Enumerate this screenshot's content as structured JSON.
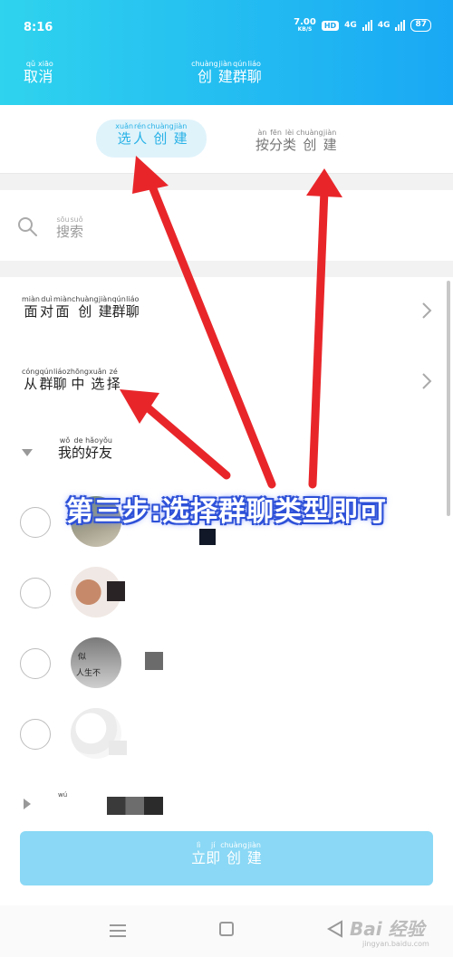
{
  "status_bar": {
    "time": "8:16",
    "speed_value": "7.00",
    "speed_unit": "KB/S",
    "hd": "HD",
    "net1": "4G",
    "net2": "4G",
    "battery": "87"
  },
  "header": {
    "cancel": {
      "chars": [
        "取",
        "消"
      ],
      "pinyin": [
        "qǔ",
        "xiāo"
      ]
    },
    "title": {
      "chars": [
        "创",
        "建",
        "群",
        "聊"
      ],
      "pinyin": [
        "chuàng",
        "jiàn",
        "qún",
        "liáo"
      ]
    }
  },
  "tabs": {
    "active": {
      "chars": [
        "选",
        "人",
        "创",
        "建"
      ],
      "pinyin": [
        "xuǎn",
        "rén",
        "chuàng",
        "jiàn"
      ]
    },
    "other": {
      "chars": [
        "按",
        "分",
        "类",
        "创",
        "建"
      ],
      "pinyin": [
        "àn",
        "fēn",
        "lèi",
        "chuàng",
        "jiàn"
      ]
    }
  },
  "search": {
    "chars": [
      "搜",
      "索"
    ],
    "pinyin": [
      "sōu",
      "suǒ"
    ]
  },
  "menu": {
    "face_to_face": {
      "chars": [
        "面",
        "对",
        "面",
        "创",
        "建",
        "群",
        "聊"
      ],
      "pinyin": [
        "miàn",
        "duì",
        "miàn",
        "chuàng",
        "jiàn",
        "qún",
        "liáo"
      ]
    },
    "from_group": {
      "chars": [
        "从",
        "群",
        "聊",
        "中",
        "选",
        "择"
      ],
      "pinyin": [
        "cóng",
        "qún",
        "liáo",
        "zhōng",
        "xuǎn",
        "zé"
      ]
    }
  },
  "friends": {
    "header": {
      "chars": [
        "我",
        "的",
        "好",
        "友"
      ],
      "pinyin": [
        "wǒ",
        "de",
        "hǎo",
        "yǒu"
      ]
    },
    "avatar_text": [
      "似",
      "人生不"
    ],
    "collapsed_group_pinyin": "wú"
  },
  "create_button": {
    "chars": [
      "立",
      "即",
      "创",
      "建"
    ],
    "pinyin": [
      "lì",
      "jí",
      "chuàng",
      "jiàn"
    ]
  },
  "annotation": {
    "caption": "第三步:选择群聊类型即可",
    "arrow_color": "#e8262a"
  },
  "watermark": {
    "main": "Bai 经验",
    "sub": "jingyan.baidu.com"
  },
  "colors": {
    "header_start": "#2fd3ee",
    "header_end": "#19a8f4",
    "accent": "#28b2e6",
    "button": "#8ad8f5"
  }
}
